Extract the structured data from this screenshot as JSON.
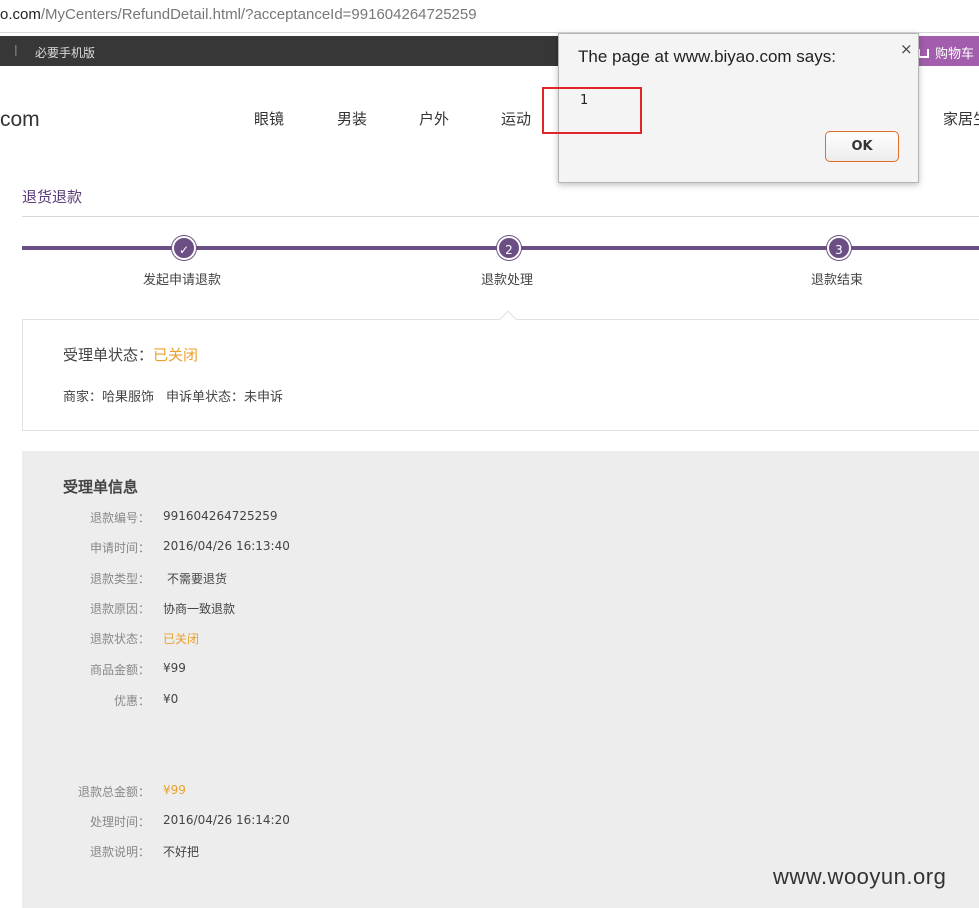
{
  "browser": {
    "url_host": "o.com",
    "url_path": "/MyCenters/RefundDetail.html/?acceptanceId=991604264725259"
  },
  "topbar": {
    "separator": "|",
    "mobile_label": "必要手机版",
    "cart_label": "购物车"
  },
  "header": {
    "logo_text": "com",
    "nav": [
      "眼镜",
      "男装",
      "户外",
      "运动"
    ],
    "nav_right": "家居生"
  },
  "section": {
    "title": "退货退款"
  },
  "progress": {
    "steps": [
      {
        "marker": "✓",
        "label": "发起申请退款"
      },
      {
        "marker": "2",
        "label": "退款处理"
      },
      {
        "marker": "3",
        "label": "退款结束"
      }
    ],
    "current_step": 2
  },
  "status": {
    "label": "受理单状态：",
    "value": "已关闭",
    "merchant": "商家：哈果服饰",
    "appeal": "申诉单状态：未申诉"
  },
  "info": {
    "title": "受理单信息",
    "rows": [
      {
        "key": "退款编号：",
        "value": "991604264725259"
      },
      {
        "key": "申请时间：",
        "value": "2016/04/26 16:13:40"
      },
      {
        "key": "退款类型：",
        "value": "不需要退货"
      },
      {
        "key": "退款原因：",
        "value": "协商一致退款"
      },
      {
        "key": "退款状态：",
        "value": "已关闭"
      },
      {
        "key": "商品金额：",
        "value": "¥99"
      },
      {
        "key": "优惠：",
        "value": "¥0"
      },
      {
        "key": "退款总金额：",
        "value": "¥99"
      },
      {
        "key": "处理时间：",
        "value": "2016/04/26 16:14:20"
      },
      {
        "key": "退款说明：",
        "value": "不好把"
      }
    ]
  },
  "alert": {
    "title": "The page at www.biyao.com says:",
    "close": "×",
    "message": "1",
    "ok_label": "OK"
  },
  "watermark": "www.wooyun.org",
  "colors": {
    "accent_purple": "#6b4f84",
    "status_orange": "#e8a12e",
    "cart_purple": "#a25dac",
    "highlight_red": "#e0262a"
  }
}
